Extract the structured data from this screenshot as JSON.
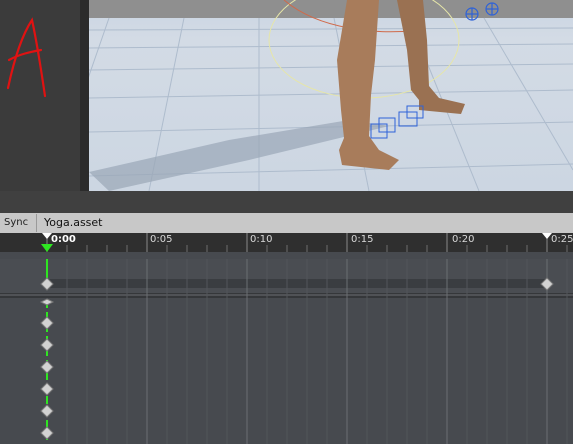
{
  "header": {
    "sync_label": "Sync",
    "clip_name": "Yoga.asset"
  },
  "ruler": {
    "labels": [
      "0:00",
      "0:05",
      "0:10",
      "0:15",
      "0:20",
      "0:25"
    ]
  },
  "colors": {
    "playhead": "#2ee621",
    "annotation": "#e01212",
    "gizmo_blue": "#2e62d8"
  }
}
